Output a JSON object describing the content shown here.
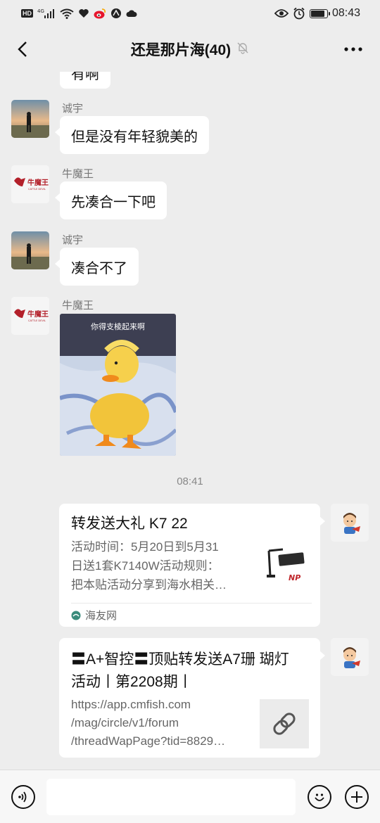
{
  "status_bar": {
    "network_label": "HD",
    "signal_label": "4G",
    "time": "08:43",
    "battery_level": 0.9
  },
  "header": {
    "title": "还是那片海(40)"
  },
  "messages": [
    {
      "type": "text_partial",
      "text": "有啊"
    },
    {
      "type": "text",
      "sender": "诚宇",
      "text": "但是没有年轻貌美的"
    },
    {
      "type": "text",
      "sender": "牛魔王",
      "text": "先凑合一下吧",
      "avatar_text": "牛魔王",
      "avatar_sub": "CATTLE DEVIL"
    },
    {
      "type": "text",
      "sender": "诚宇",
      "text": "凑合不了"
    },
    {
      "type": "image",
      "sender": "牛魔王",
      "image_caption": "你得支棱起来啊",
      "avatar_text": "牛魔王",
      "avatar_sub": "CATTLE DEVIL"
    }
  ],
  "timestamp": "08:41",
  "cards": [
    {
      "title": "转发送大礼 K7 22",
      "desc_lines": [
        "活动时间：5月20日到5月31",
        "日送1套K7140W活动规则：",
        "把本贴活动分享到海水相关…"
      ],
      "source": "海友网",
      "thumb_label": "NP"
    },
    {
      "title_lines": [
        "〓A+智控〓顶贴转发送A7珊 瑚灯",
        "活动丨第2208期丨"
      ],
      "desc_lines": [
        "https://app.cmfish.com",
        "/mag/circle/v1/forum",
        "/threadWapPage?tid=8829…"
      ]
    }
  ],
  "input": {
    "placeholder": ""
  },
  "colors": {
    "background": "#ededed",
    "bubble": "#ffffff",
    "accent_red": "#c0282d"
  }
}
